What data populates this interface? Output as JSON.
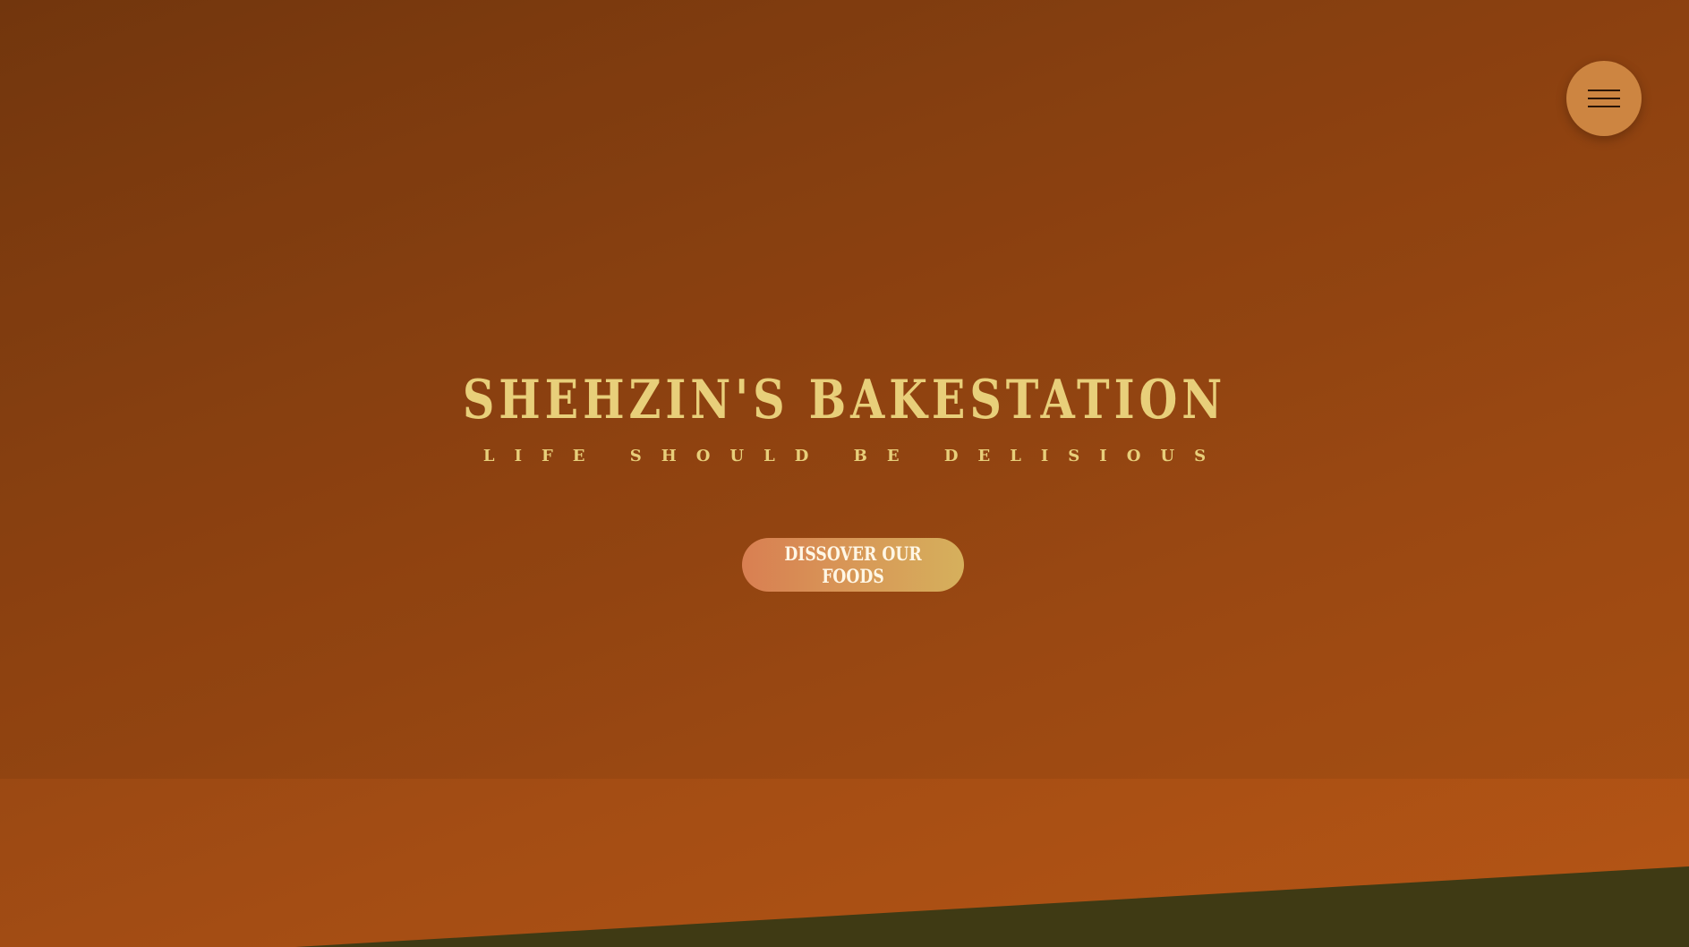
{
  "hero": {
    "title": "SHEHZIN'S BAKESTATION",
    "tagline": "LIFE SHOULD BE DELISIOUS",
    "cta_label": "DISSOVER OUR FOODS"
  },
  "nav": {
    "menu_icon": "hamburger-icon"
  },
  "colors": {
    "title": "#e8cf7a",
    "menu_button": "#cd8541",
    "cta_start": "#d97f52",
    "cta_end": "#d6b05c",
    "wedge": "#3f3a14"
  }
}
